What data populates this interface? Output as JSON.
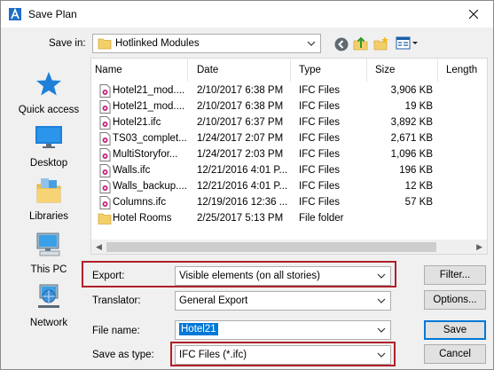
{
  "window": {
    "title": "Save Plan"
  },
  "save_in": {
    "label": "Save in:",
    "value": "Hotlinked Modules"
  },
  "toolbar": {
    "icons": [
      "back-icon",
      "up-folder-icon",
      "new-folder-icon",
      "view-menu-icon"
    ]
  },
  "places": [
    {
      "label": "Quick access",
      "icon": "quick-access-icon"
    },
    {
      "label": "Desktop",
      "icon": "desktop-icon"
    },
    {
      "label": "Libraries",
      "icon": "libraries-icon"
    },
    {
      "label": "This PC",
      "icon": "this-pc-icon"
    },
    {
      "label": "Network",
      "icon": "network-icon"
    }
  ],
  "file_list": {
    "columns": [
      "Name",
      "Date",
      "Type",
      "Size",
      "Length"
    ],
    "rows": [
      {
        "name": "Hotel21_mod....",
        "date": "2/10/2017 6:38 PM",
        "type": "IFC Files",
        "size": "3,906 KB",
        "icon": "ifc-file-icon"
      },
      {
        "name": "Hotel21_mod....",
        "date": "2/10/2017 6:38 PM",
        "type": "IFC Files",
        "size": "19 KB",
        "icon": "ifc-file-icon"
      },
      {
        "name": "Hotel21.ifc",
        "date": "2/10/2017 6:37 PM",
        "type": "IFC Files",
        "size": "3,892 KB",
        "icon": "ifc-file-icon"
      },
      {
        "name": "TS03_complet...",
        "date": "1/24/2017 2:07 PM",
        "type": "IFC Files",
        "size": "2,671 KB",
        "icon": "ifc-file-icon"
      },
      {
        "name": "MultiStoryfor...",
        "date": "1/24/2017 2:03 PM",
        "type": "IFC Files",
        "size": "1,096 KB",
        "icon": "ifc-file-icon"
      },
      {
        "name": "Walls.ifc",
        "date": "12/21/2016 4:01 P...",
        "type": "IFC Files",
        "size": "196 KB",
        "icon": "ifc-file-icon"
      },
      {
        "name": "Walls_backup....",
        "date": "12/21/2016 4:01 P...",
        "type": "IFC Files",
        "size": "12 KB",
        "icon": "ifc-file-icon"
      },
      {
        "name": "Columns.ifc",
        "date": "12/19/2016 12:36 ...",
        "type": "IFC Files",
        "size": "57 KB",
        "icon": "ifc-file-icon"
      },
      {
        "name": "Hotel Rooms",
        "date": "2/25/2017 5:13 PM",
        "type": "File folder",
        "size": "",
        "icon": "folder-icon"
      }
    ]
  },
  "export": {
    "label": "Export:",
    "value": "Visible elements (on all stories)"
  },
  "translator": {
    "label": "Translator:",
    "value": "General Export"
  },
  "file_name": {
    "label": "File name:",
    "value": "Hotel21"
  },
  "save_as_type": {
    "label": "Save as type:",
    "value": "IFC Files (*.ifc)"
  },
  "buttons": {
    "filter": "Filter...",
    "options": "Options...",
    "save": "Save",
    "cancel": "Cancel"
  },
  "colors": {
    "highlight_box": "#b02028",
    "selection": "#0078d7"
  }
}
